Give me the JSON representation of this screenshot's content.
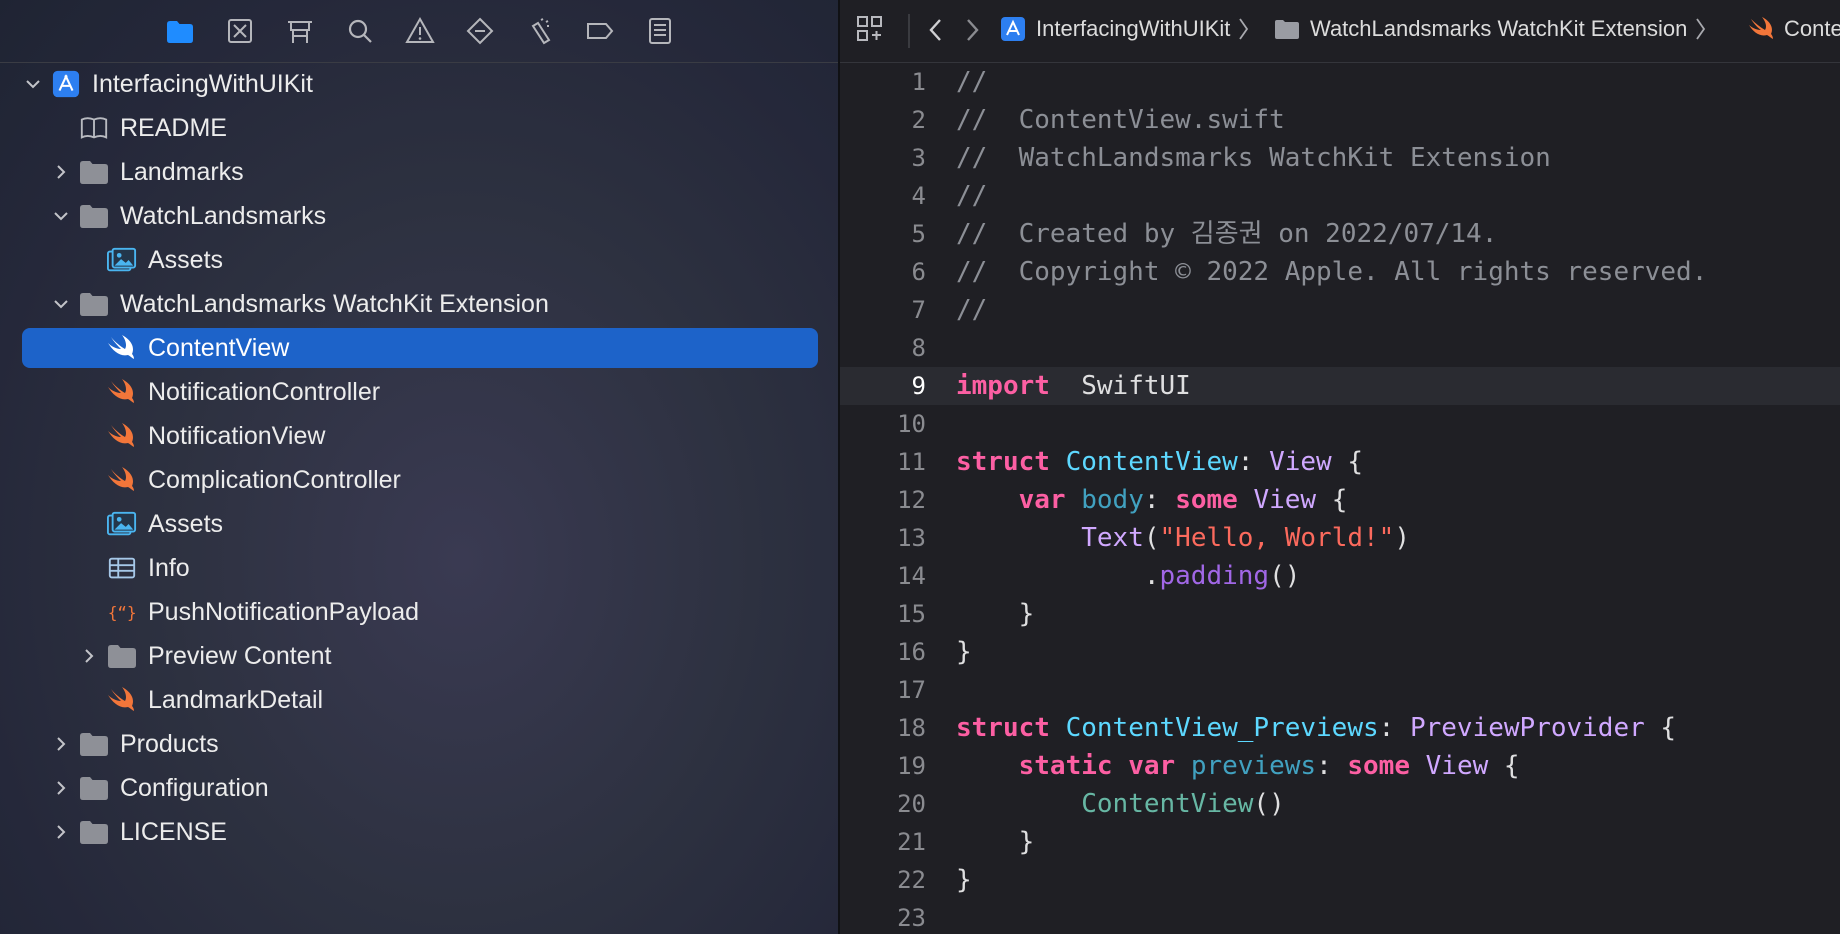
{
  "navigator": {
    "toolbar": [
      "folder-icon",
      "source-control-icon",
      "symbol-icon",
      "find-icon",
      "issue-icon",
      "test-icon",
      "debug-icon",
      "breakpoint-icon",
      "report-icon"
    ],
    "items": [
      {
        "label": "InterfacingWithUIKit",
        "icon": "project-icon",
        "level": 0,
        "disclosure": "open"
      },
      {
        "label": "README",
        "icon": "book-icon",
        "level": 1,
        "disclosure": "none"
      },
      {
        "label": "Landmarks",
        "icon": "folder-icon",
        "level": 1,
        "disclosure": "closed"
      },
      {
        "label": "WatchLandsmarks",
        "icon": "folder-icon",
        "level": 1,
        "disclosure": "open"
      },
      {
        "label": "Assets",
        "icon": "assets-icon",
        "level": 2,
        "disclosure": "none"
      },
      {
        "label": "WatchLandsmarks WatchKit Extension",
        "icon": "folder-icon",
        "level": 1,
        "disclosure": "open"
      },
      {
        "label": "ContentView",
        "icon": "swift-icon",
        "level": 2,
        "disclosure": "none",
        "selected": true
      },
      {
        "label": "NotificationController",
        "icon": "swift-icon",
        "level": 2,
        "disclosure": "none"
      },
      {
        "label": "NotificationView",
        "icon": "swift-icon",
        "level": 2,
        "disclosure": "none"
      },
      {
        "label": "ComplicationController",
        "icon": "swift-icon",
        "level": 2,
        "disclosure": "none"
      },
      {
        "label": "Assets",
        "icon": "assets-icon",
        "level": 2,
        "disclosure": "none"
      },
      {
        "label": "Info",
        "icon": "plist-icon",
        "level": 2,
        "disclosure": "none"
      },
      {
        "label": "PushNotificationPayload",
        "icon": "json-icon",
        "level": 2,
        "disclosure": "none"
      },
      {
        "label": "Preview Content",
        "icon": "folder-icon",
        "level": 2,
        "disclosure": "closed"
      },
      {
        "label": "LandmarkDetail",
        "icon": "swift-icon",
        "level": 2,
        "disclosure": "none"
      },
      {
        "label": "Products",
        "icon": "folder-icon",
        "level": 1,
        "disclosure": "closed"
      },
      {
        "label": "Configuration",
        "icon": "folder-icon",
        "level": 1,
        "disclosure": "closed"
      },
      {
        "label": "LICENSE",
        "icon": "folder-icon",
        "level": 1,
        "disclosure": "closed"
      }
    ]
  },
  "editor": {
    "jump_bar": {
      "project": "InterfacingWithUIKit",
      "group": "WatchLandsmarks WatchKit Extension",
      "file": "Conte"
    },
    "current_line": 9,
    "lines": [
      [
        [
          "c",
          "//"
        ]
      ],
      [
        [
          "c",
          "//  ContentView.swift"
        ]
      ],
      [
        [
          "c",
          "//  WatchLandsmarks WatchKit Extension"
        ]
      ],
      [
        [
          "c",
          "//"
        ]
      ],
      [
        [
          "c",
          "//  Created by 김종권 on 2022/07/14."
        ]
      ],
      [
        [
          "c",
          "//  Copyright © 2022 Apple. All rights reserved."
        ]
      ],
      [
        [
          "c",
          "//"
        ]
      ],
      [],
      [
        [
          "k",
          "import"
        ],
        [
          "",
          "  SwiftUI"
        ]
      ],
      [],
      [
        [
          "k",
          "struct"
        ],
        [
          "",
          " "
        ],
        [
          "t",
          "ContentView"
        ],
        [
          "",
          ": "
        ],
        [
          "p",
          "View"
        ],
        [
          "",
          " {"
        ]
      ],
      [
        [
          "",
          "    "
        ],
        [
          "k",
          "var"
        ],
        [
          "",
          " "
        ],
        [
          "vn",
          "body"
        ],
        [
          "",
          ": "
        ],
        [
          "k",
          "some"
        ],
        [
          "",
          " "
        ],
        [
          "p",
          "View"
        ],
        [
          "",
          " {"
        ]
      ],
      [
        [
          "",
          "        "
        ],
        [
          "p",
          "Text"
        ],
        [
          "",
          "("
        ],
        [
          "s",
          "\"Hello, World!\""
        ],
        [
          "",
          ")"
        ]
      ],
      [
        [
          "",
          "            ."
        ],
        [
          "f",
          "padding"
        ],
        [
          "",
          "()"
        ]
      ],
      [
        [
          "",
          "    }"
        ]
      ],
      [
        [
          "",
          "}"
        ]
      ],
      [],
      [
        [
          "k",
          "struct"
        ],
        [
          "",
          " "
        ],
        [
          "t",
          "ContentView_Previews"
        ],
        [
          "",
          ": "
        ],
        [
          "p",
          "PreviewProvider"
        ],
        [
          "",
          " {"
        ]
      ],
      [
        [
          "",
          "    "
        ],
        [
          "k",
          "static"
        ],
        [
          "",
          " "
        ],
        [
          "k",
          "var"
        ],
        [
          "",
          " "
        ],
        [
          "vn",
          "previews"
        ],
        [
          "",
          ": "
        ],
        [
          "k",
          "some"
        ],
        [
          "",
          " "
        ],
        [
          "p",
          "View"
        ],
        [
          "",
          " {"
        ]
      ],
      [
        [
          "",
          "        "
        ],
        [
          "g",
          "ContentView"
        ],
        [
          "",
          "()"
        ]
      ],
      [
        [
          "",
          "    }"
        ]
      ],
      [
        [
          "",
          "}"
        ]
      ],
      []
    ]
  },
  "colors": {
    "selection": "#1d63c9",
    "keyword": "#fc5fa3",
    "type": "#5dd8ff",
    "string": "#fc6a5d",
    "swift": "#f2763a",
    "folder": "#8e9097",
    "accent": "#1f8cff"
  }
}
